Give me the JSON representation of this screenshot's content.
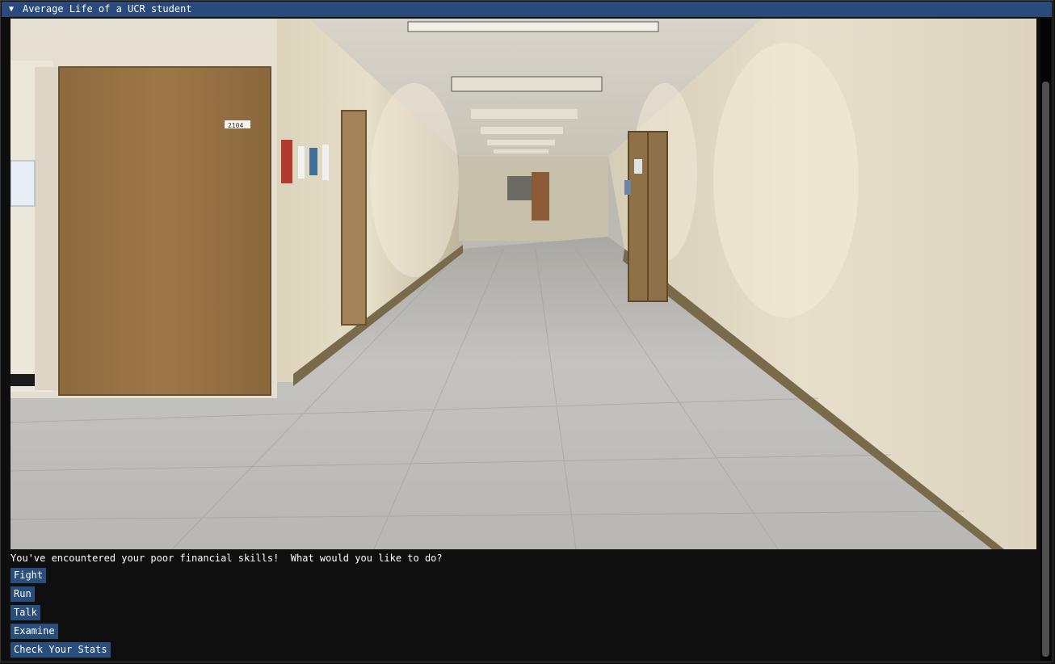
{
  "window": {
    "title": "Average Life of a UCR student",
    "collapse_icon": "triangle-down-icon"
  },
  "scene": {
    "image": "hallway-photo",
    "room_number": "2104"
  },
  "prompt": "You've encountered your poor financial skills!  What would you like to do?",
  "actions": [
    "Fight",
    "Run",
    "Talk",
    "Examine",
    "Check Your Stats"
  ],
  "colors": {
    "titlebar": "#294a7a",
    "button": "#2a4e7c",
    "background": "#0f0f0f"
  }
}
